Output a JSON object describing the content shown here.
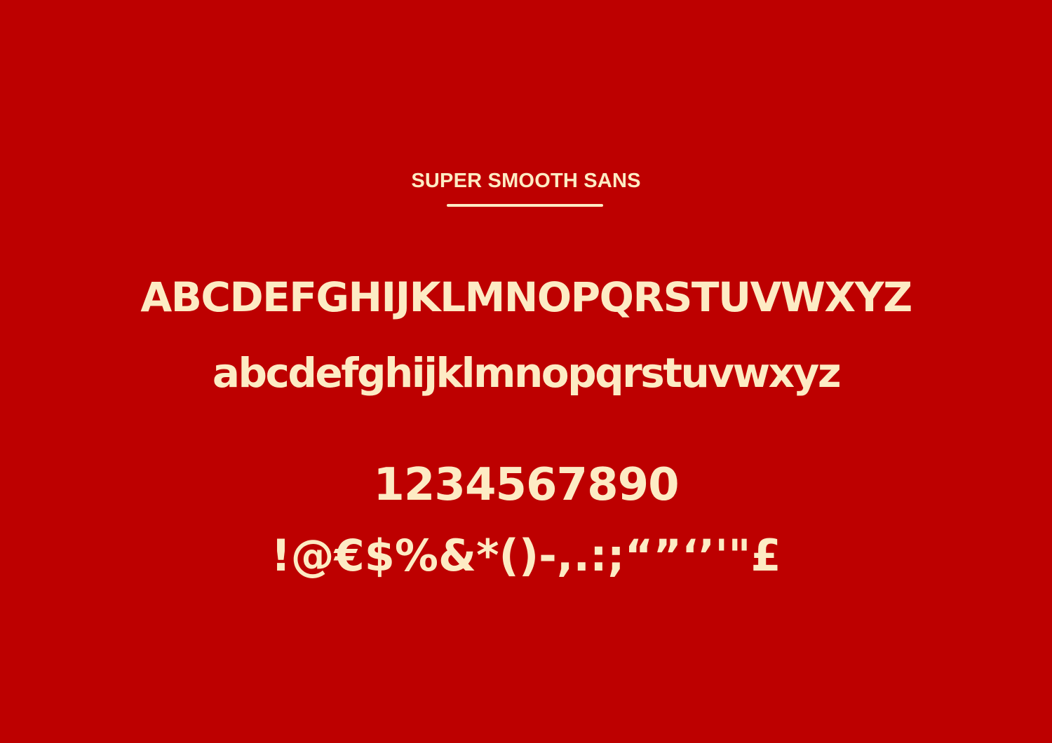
{
  "theme": {
    "background": "#bd0000",
    "foreground": "#fdebc4"
  },
  "specimen": {
    "title": "SUPER SMOOTH SANS",
    "uppercase": "ABCDEFGHIJKLMNOPQRSTUVWXYZ",
    "lowercase": "abcdefghijklmnopqrstuvwxyz",
    "numerals": "1234567890",
    "symbols": "!@€$%&*()-,.:;“”‘’'\"£"
  }
}
